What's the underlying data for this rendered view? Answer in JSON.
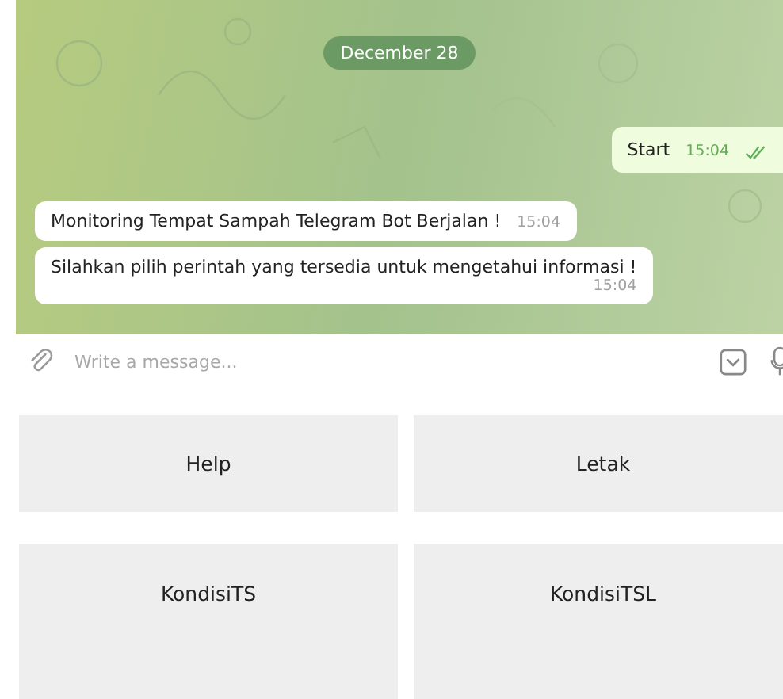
{
  "chat": {
    "date": "December 28",
    "messages": [
      {
        "kind": "outgoing",
        "text": "Start",
        "time": "15:04",
        "read": true
      },
      {
        "kind": "incoming",
        "text": "Monitoring Tempat Sampah Telegram Bot Berjalan !",
        "time": "15:04"
      },
      {
        "kind": "incoming",
        "text": "Silahkan pilih perintah yang tersedia untuk mengetahui informasi !",
        "time": "15:04",
        "time_below": true
      }
    ]
  },
  "composer": {
    "placeholder": "Write a message..."
  },
  "keyboard": {
    "rows": [
      [
        "Help",
        "Letak"
      ],
      [
        "KondisiTS",
        "KondisiTSL"
      ]
    ]
  }
}
